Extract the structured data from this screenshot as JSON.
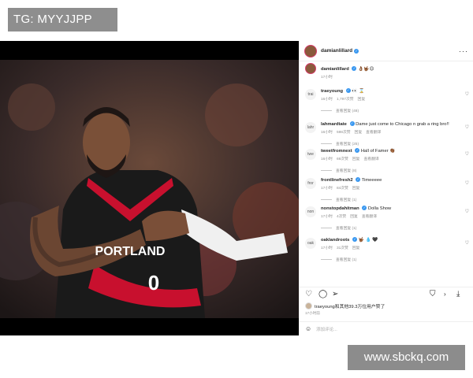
{
  "watermarks": {
    "top": "TG: MYYJJPP",
    "bottom": "www.sbckq.com"
  },
  "post_header": {
    "username": "damianlillard",
    "more_icon": "more-horizontal-icon"
  },
  "caption": {
    "username": "damianlillard",
    "text": "👌🏾🤟🏾😌",
    "time": "17小时"
  },
  "jersey": {
    "team": "PORTLAND",
    "number": "0"
  },
  "comments": [
    {
      "avatar": "trai",
      "username": "traeyoung",
      "verified": true,
      "text": "👀 ⌛",
      "time": "16小时",
      "likes": "1,797次赞",
      "reply": "回复",
      "translate": "",
      "view_replies": "查看回复 (48)"
    },
    {
      "avatar": "lahr",
      "username": "lahmardtate",
      "verified": true,
      "text": "Dame just come to Chicago n grab a ring bro!!",
      "time": "16小时",
      "likes": "598次赞",
      "reply": "回复",
      "translate": "查看翻译",
      "view_replies": "查看回复 (25)"
    },
    {
      "avatar": "twe",
      "username": "tweetfromnext",
      "verified": true,
      "text": "Hall of Famer 👏🏾",
      "time": "16小时",
      "likes": "69次赞",
      "reply": "回复",
      "translate": "查看翻译",
      "view_replies": "查看回复 (8)"
    },
    {
      "avatar": "fror",
      "username": "frontlinefresh2",
      "verified": true,
      "text": "Timeeeee",
      "time": "17小时",
      "likes": "84次赞",
      "reply": "回复",
      "translate": "",
      "view_replies": "查看回复 (1)"
    },
    {
      "avatar": "non",
      "username": "nonstopdahitman",
      "verified": true,
      "text": "Dolla Show",
      "time": "17小时",
      "likes": "4次赞",
      "reply": "回复",
      "translate": "查看翻译",
      "view_replies": "查看回复 (1)"
    },
    {
      "avatar": "oak",
      "username": "oaklandroots",
      "verified": true,
      "text": "🤟🏾 💧 🖤",
      "time": "17小时",
      "likes": "31次赞",
      "reply": "回复",
      "translate": "",
      "view_replies": "查看回复 (1)"
    }
  ],
  "actions": {
    "like_icon": "heart-icon",
    "comment_icon": "comment-icon",
    "share_icon": "send-icon",
    "save_icon": "bookmark-icon",
    "arrow": "›",
    "download_icon": "download-icon"
  },
  "likes_line": {
    "text": "traeyoung和其他39.3万位用户赞了"
  },
  "post_date": "17小时前",
  "add_comment": {
    "placeholder": "添加评论..."
  },
  "colors": {
    "verified": "#3897f0",
    "story_ring": "#d63c6a",
    "jersey_red": "#c8102e",
    "jersey_black": "#1a1a1a"
  }
}
